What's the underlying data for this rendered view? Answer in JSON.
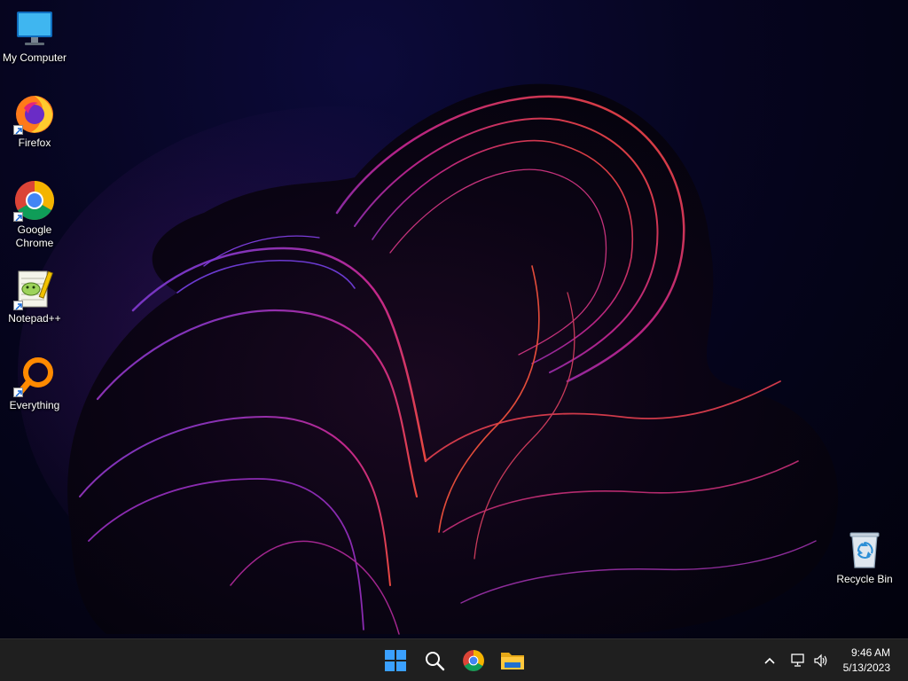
{
  "desktop": {
    "icons": [
      {
        "label": "My Computer",
        "icon": "monitor-icon"
      },
      {
        "label": "Firefox",
        "icon": "firefox-icon"
      },
      {
        "label": "Google Chrome",
        "icon": "chrome-icon"
      },
      {
        "label": "Notepad++",
        "icon": "notepadpp-icon"
      },
      {
        "label": "Everything",
        "icon": "everything-search-icon"
      },
      {
        "label": "Recycle Bin",
        "icon": "recycle-bin-icon"
      }
    ]
  },
  "taskbar": {
    "buttons": [
      {
        "name": "start",
        "icon": "windows-start-icon"
      },
      {
        "name": "search",
        "icon": "search-icon"
      },
      {
        "name": "chrome",
        "icon": "chrome-icon"
      },
      {
        "name": "file-explorer",
        "icon": "folder-icon"
      }
    ],
    "tray": {
      "icons": [
        "chevron-up-icon",
        "network-icon",
        "speaker-icon"
      ],
      "time": "9:46 AM",
      "date": "5/13/2023"
    }
  },
  "colors": {
    "taskbar": "#1f1f1f",
    "accent": "#3aa0ff",
    "wallpaper_glow": "#c0268c"
  }
}
